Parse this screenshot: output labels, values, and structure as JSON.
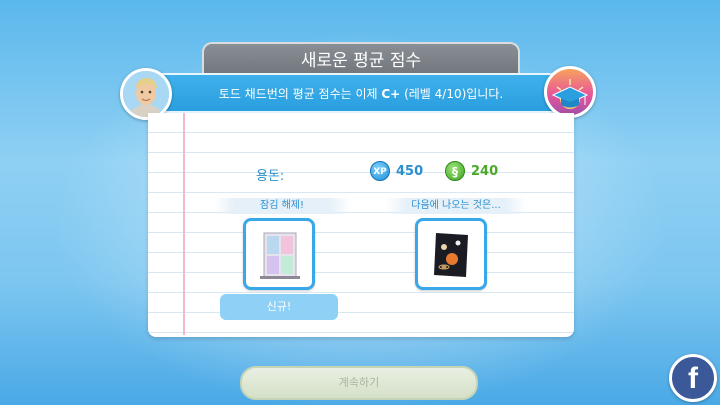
{
  "dialog": {
    "title": "새로운 평균 점수",
    "message_prefix": "토드 채드번의 평균 점수는 이제 ",
    "message_grade": "C+",
    "message_suffix": " (레벨 4/10)입니다."
  },
  "rewards": {
    "label": "용돈:",
    "xp": {
      "icon_text": "XP",
      "value": "450"
    },
    "simoleons": {
      "icon_text": "§",
      "value": "240"
    }
  },
  "unlock": {
    "heading": "잠김 해제!",
    "item_icon": "closet-icon",
    "badge": "신규!"
  },
  "next": {
    "heading": "다음에 나오는 것은...",
    "item_icon": "solar-system-poster-icon"
  },
  "continue_button": "계속하기",
  "facebook_button": "f",
  "colors": {
    "banner": "#2a9fe0",
    "accent": "#2b8fcf",
    "simoleon": "#4aa82a",
    "facebook": "#3b5998"
  }
}
